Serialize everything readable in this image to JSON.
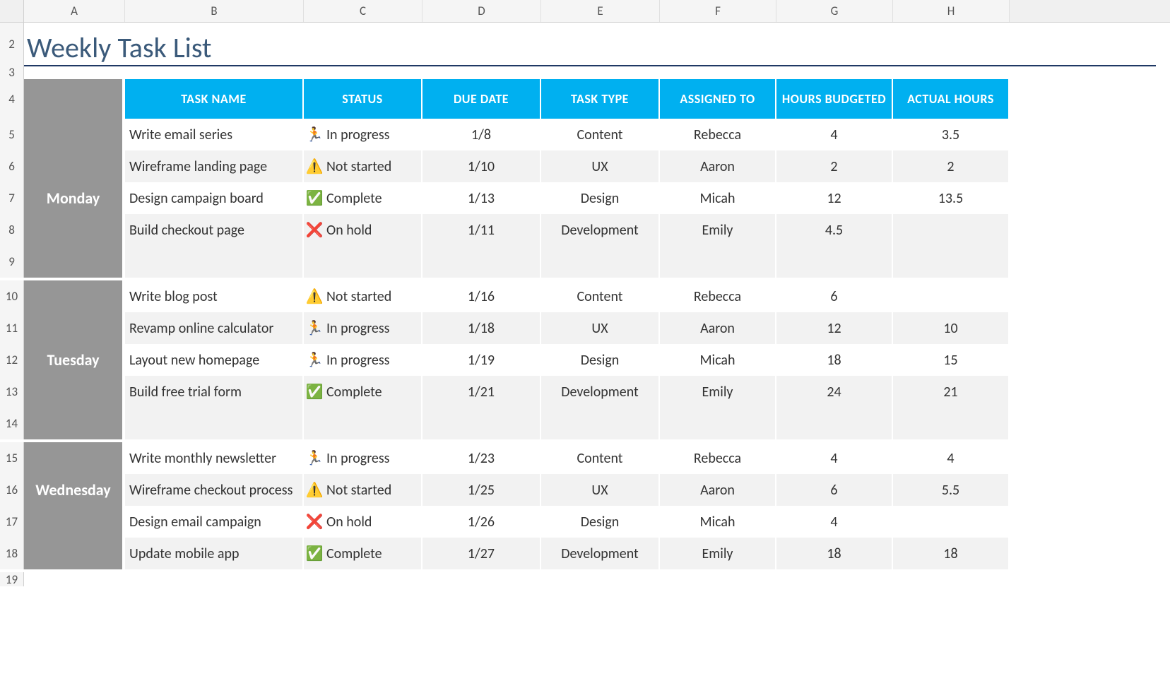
{
  "title": "Weekly Task List",
  "columns": [
    "A",
    "B",
    "C",
    "D",
    "E",
    "F",
    "G",
    "H"
  ],
  "rowNumbers": [
    "2",
    "3",
    "4",
    "5",
    "6",
    "7",
    "8",
    "9",
    "10",
    "11",
    "12",
    "13",
    "14",
    "15",
    "16",
    "17",
    "18",
    "19"
  ],
  "headers": {
    "taskName": "TASK NAME",
    "status": "STATUS",
    "dueDate": "DUE DATE",
    "taskType": "TASK TYPE",
    "assignedTo": "ASSIGNED TO",
    "hoursBudgeted": "HOURS BUDGETED",
    "actualHours": "ACTUAL HOURS"
  },
  "statusIcons": {
    "In progress": "icon-progress",
    "Not started": "icon-notstarted",
    "Complete": "icon-complete",
    "On hold": "icon-onhold"
  },
  "groups": [
    {
      "day": "Monday",
      "hasTrailingBlank": true,
      "tasks": [
        {
          "name": "Write email series",
          "status": "In progress",
          "due": "1/8",
          "type": "Content",
          "assigned": "Rebecca",
          "budgeted": "4",
          "actual": "3.5"
        },
        {
          "name": "Wireframe landing page",
          "status": "Not started",
          "due": "1/10",
          "type": "UX",
          "assigned": "Aaron",
          "budgeted": "2",
          "actual": "2"
        },
        {
          "name": "Design campaign board",
          "status": "Complete",
          "due": "1/13",
          "type": "Design",
          "assigned": "Micah",
          "budgeted": "12",
          "actual": "13.5"
        },
        {
          "name": "Build checkout page",
          "status": "On hold",
          "due": "1/11",
          "type": "Development",
          "assigned": "Emily",
          "budgeted": "4.5",
          "actual": ""
        }
      ]
    },
    {
      "day": "Tuesday",
      "hasTrailingBlank": true,
      "tasks": [
        {
          "name": "Write blog post",
          "status": "Not started",
          "due": "1/16",
          "type": "Content",
          "assigned": "Rebecca",
          "budgeted": "6",
          "actual": ""
        },
        {
          "name": "Revamp online calculator",
          "status": "In progress",
          "due": "1/18",
          "type": "UX",
          "assigned": "Aaron",
          "budgeted": "12",
          "actual": "10"
        },
        {
          "name": "Layout new homepage",
          "status": "In progress",
          "due": "1/19",
          "type": "Design",
          "assigned": "Micah",
          "budgeted": "18",
          "actual": "15"
        },
        {
          "name": "Build free trial form",
          "status": "Complete",
          "due": "1/21",
          "type": "Development",
          "assigned": "Emily",
          "budgeted": "24",
          "actual": "21"
        }
      ]
    },
    {
      "day": "Wednesday",
      "hasTrailingBlank": false,
      "tasks": [
        {
          "name": "Write monthly newsletter",
          "status": "In progress",
          "due": "1/23",
          "type": "Content",
          "assigned": "Rebecca",
          "budgeted": "4",
          "actual": "4"
        },
        {
          "name": "Wireframe checkout process",
          "status": "Not started",
          "due": "1/25",
          "type": "UX",
          "assigned": "Aaron",
          "budgeted": "6",
          "actual": "5.5"
        },
        {
          "name": "Design email campaign",
          "status": "On hold",
          "due": "1/26",
          "type": "Design",
          "assigned": "Micah",
          "budgeted": "4",
          "actual": ""
        },
        {
          "name": "Update mobile app",
          "status": "Complete",
          "due": "1/27",
          "type": "Development",
          "assigned": "Emily",
          "budgeted": "18",
          "actual": "18"
        }
      ]
    }
  ]
}
